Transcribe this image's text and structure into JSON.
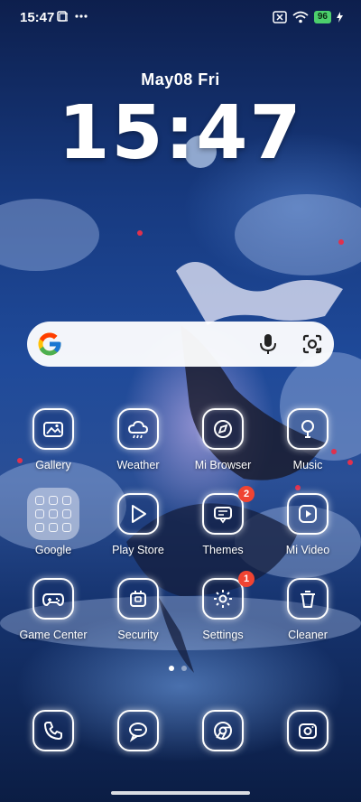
{
  "status_bar": {
    "time": "15:47",
    "battery": "96"
  },
  "lock": {
    "date": "May08  Fri",
    "clock": "15:47"
  },
  "apps": [
    {
      "label": "Gallery",
      "icon": "gallery-icon"
    },
    {
      "label": "Weather",
      "icon": "weather-icon"
    },
    {
      "label": "Mi Browser",
      "icon": "browser-icon"
    },
    {
      "label": "Music",
      "icon": "music-icon"
    },
    {
      "label": "Google",
      "icon": "google-folder-icon"
    },
    {
      "label": "Play Store",
      "icon": "play-store-icon"
    },
    {
      "label": "Themes",
      "icon": "themes-icon",
      "badge": "2"
    },
    {
      "label": "Mi Video",
      "icon": "video-icon"
    },
    {
      "label": "Game Center",
      "icon": "gamepad-icon"
    },
    {
      "label": "Security",
      "icon": "security-icon"
    },
    {
      "label": "Settings",
      "icon": "settings-icon",
      "badge": "1"
    },
    {
      "label": "Cleaner",
      "icon": "cleaner-icon"
    }
  ],
  "dock": [
    {
      "icon": "phone-icon"
    },
    {
      "icon": "messages-icon"
    },
    {
      "icon": "chrome-icon"
    },
    {
      "icon": "camera-icon"
    }
  ],
  "colors": {
    "badge": "#f04432",
    "battery": "#4ccf6c"
  }
}
